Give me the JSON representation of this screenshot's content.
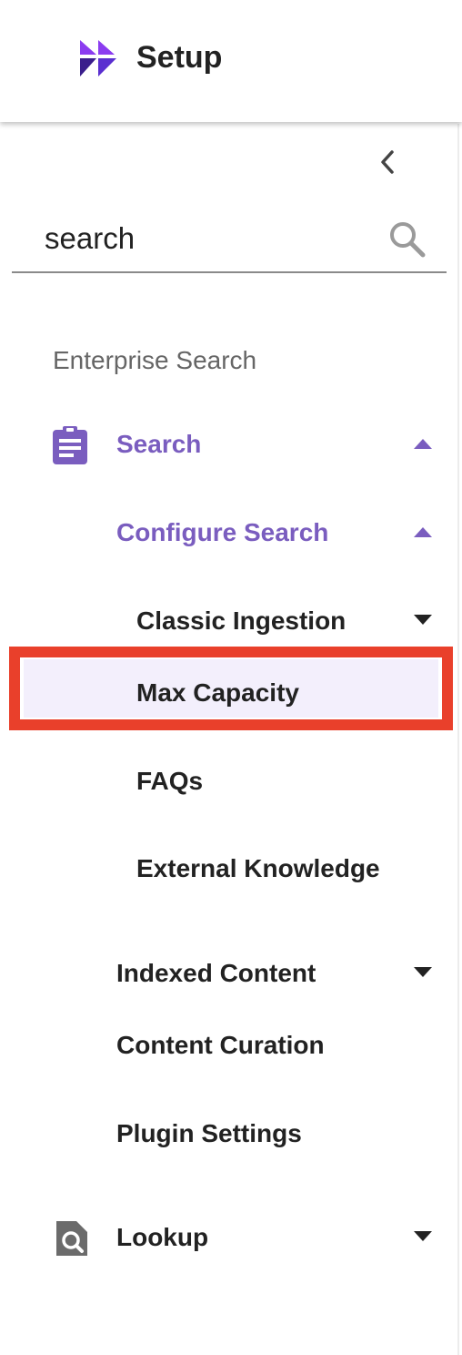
{
  "header": {
    "title": "Setup",
    "logo_icon": "setup-logo-icon"
  },
  "colors": {
    "accent": "#7a5dbf",
    "highlight_border": "#e9402b",
    "selected_bg": "#f3effc",
    "text": "#222222"
  },
  "sidebar": {
    "collapse_icon": "chevron-left-icon",
    "search": {
      "placeholder": "search",
      "value": "",
      "icon": "search-icon"
    },
    "section_label": "Enterprise Search",
    "items": [
      {
        "label": "Search",
        "icon": "clipboard-icon",
        "caret": "up",
        "active": true
      },
      {
        "label": "Configure Search",
        "caret": "up",
        "active": true
      },
      {
        "label": "Classic Ingestion",
        "caret": "down"
      },
      {
        "label": "Max Capacity",
        "selected": true
      },
      {
        "label": "FAQs"
      },
      {
        "label": "External Knowledge"
      },
      {
        "label": "Indexed Content",
        "caret": "down"
      },
      {
        "label": "Content Curation"
      },
      {
        "label": "Plugin Settings"
      },
      {
        "label": "Lookup",
        "icon": "document-search-icon",
        "caret": "down"
      }
    ]
  }
}
